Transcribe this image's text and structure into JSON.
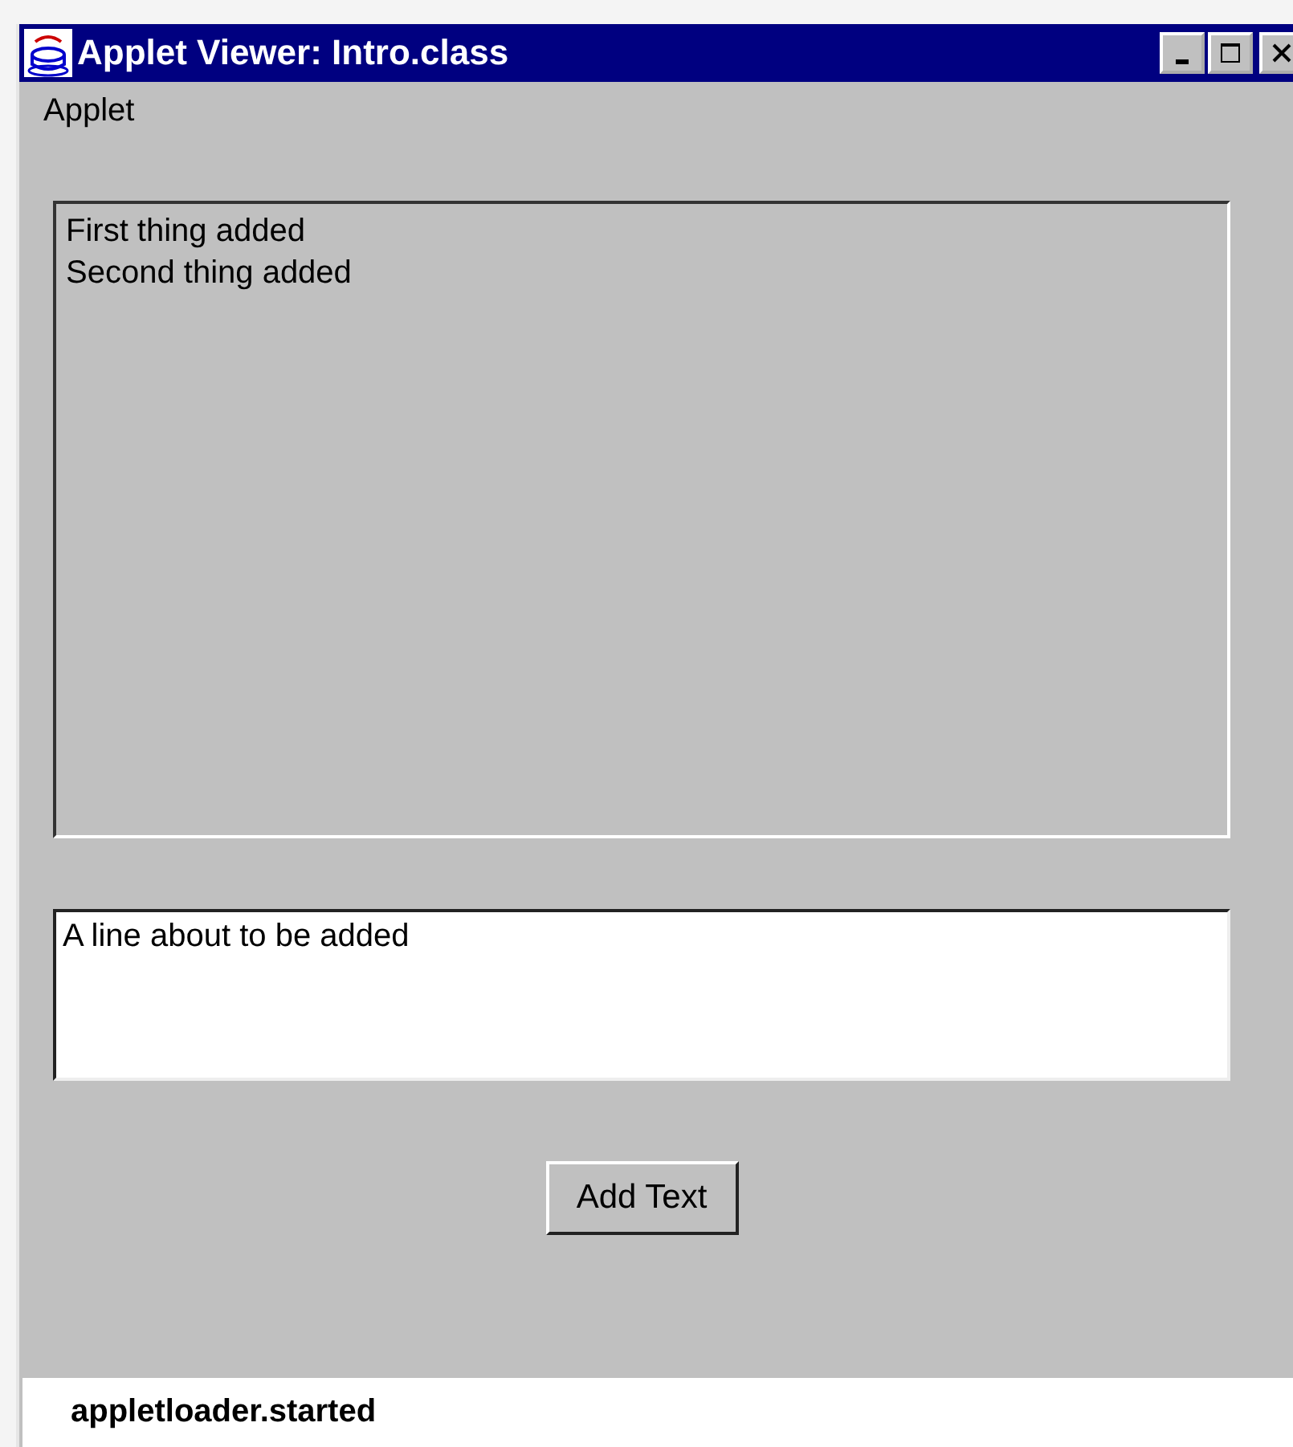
{
  "window": {
    "title": "Applet Viewer: Intro.class"
  },
  "menu_bar": {
    "items": [
      "Applet"
    ]
  },
  "text_area": {
    "lines": [
      "First thing added",
      "Second thing added"
    ]
  },
  "input": {
    "value": "A line about to be added"
  },
  "button": {
    "label": "Add Text"
  },
  "status_bar": {
    "text": "appletloader.started"
  }
}
